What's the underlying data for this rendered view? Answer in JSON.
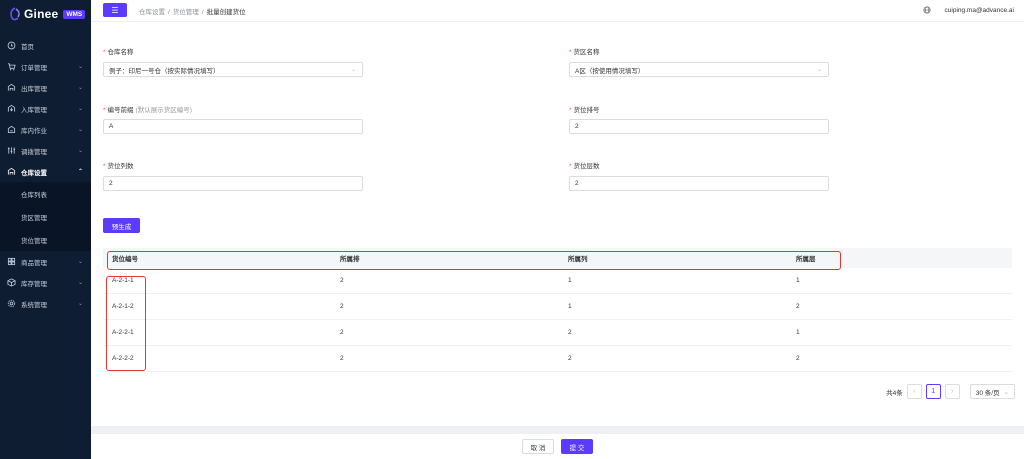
{
  "app": {
    "logo_text": "Ginee",
    "logo_badge": "WMS"
  },
  "sidebar": {
    "items": [
      {
        "label": "首页",
        "icon": "home-icon"
      },
      {
        "label": "订单管理",
        "icon": "cart-icon"
      },
      {
        "label": "出库管理",
        "icon": "outbound-icon"
      },
      {
        "label": "入库管理",
        "icon": "inbound-icon"
      },
      {
        "label": "库内作业",
        "icon": "warehouse-task-icon"
      },
      {
        "label": "调拨管理",
        "icon": "transfer-icon"
      },
      {
        "label": "仓库设置",
        "icon": "warehouse-settings-icon"
      },
      {
        "label": "商品管理",
        "icon": "product-icon"
      },
      {
        "label": "库存管理",
        "icon": "inventory-icon"
      },
      {
        "label": "系统管理",
        "icon": "gear-icon"
      }
    ],
    "sub_items": [
      {
        "label": "仓库列表"
      },
      {
        "label": "货区管理"
      },
      {
        "label": "货位管理"
      }
    ]
  },
  "header": {
    "breadcrumb": [
      "仓库设置",
      "货位管理",
      "批量创建货位"
    ],
    "user_email": "cuiping.ma@advance.ai"
  },
  "form": {
    "warehouse": {
      "label": "仓库名称",
      "value": "例子：印尼一号仓（按实际情况填写）"
    },
    "zone": {
      "label": "货区名称",
      "value": "A区（按使用情况填写）"
    },
    "prefix": {
      "label": "编号前缀",
      "hint": "(默认展示货区编号)",
      "value": "A"
    },
    "row_no": {
      "label": "货位排号",
      "value": "2"
    },
    "col_count": {
      "label": "货位列数",
      "value": "2"
    },
    "layer_count": {
      "label": "货位层数",
      "value": "2"
    },
    "generate_label": "预生成"
  },
  "table": {
    "headers": [
      "货位编号",
      "所属排",
      "所属列",
      "所属层"
    ],
    "rows": [
      [
        "A-2-1-1",
        "2",
        "1",
        "1"
      ],
      [
        "A-2-1-2",
        "2",
        "1",
        "2"
      ],
      [
        "A-2-2-1",
        "2",
        "2",
        "1"
      ],
      [
        "A-2-2-2",
        "2",
        "2",
        "2"
      ]
    ]
  },
  "pagination": {
    "total": "共4条",
    "current": "1",
    "page_size": "30 条/页"
  },
  "footer": {
    "cancel_label": "取 消",
    "submit_label": "提 交"
  },
  "colors": {
    "brand": "#5a3bff",
    "sidebar_bg": "#0f1d33",
    "highlight": "#e0392f",
    "required": "#ff4d4f"
  }
}
